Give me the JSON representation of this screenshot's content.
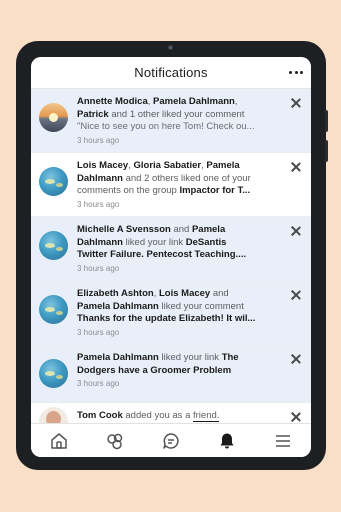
{
  "header": {
    "title": "Notifications",
    "more_icon": "more-horizontal-icon"
  },
  "notifications": [
    {
      "state": "unread",
      "avatar": "sunset-avatar",
      "lines": [
        {
          "parts": [
            [
              "b",
              "Annette Modica"
            ],
            [
              "t",
              ", "
            ],
            [
              "b",
              "Pamela Dahlmann"
            ],
            [
              "t",
              ","
            ]
          ]
        },
        {
          "parts": [
            [
              "b",
              "Patrick"
            ],
            [
              "t",
              " and 1 other liked your comment"
            ]
          ]
        },
        {
          "parts": [
            [
              "q",
              "\"Nice to see you on here Tom! Check ou..."
            ]
          ]
        }
      ],
      "time": "3 hours ago"
    },
    {
      "state": "read",
      "avatar": "ocean-avatar",
      "lines": [
        {
          "parts": [
            [
              "b",
              "Lois Macey"
            ],
            [
              "t",
              ", "
            ],
            [
              "b",
              "Gloria Sabatier"
            ],
            [
              "t",
              ", "
            ],
            [
              "b",
              "Pamela"
            ]
          ]
        },
        {
          "parts": [
            [
              "b",
              "Dahlmann"
            ],
            [
              "t",
              " and 2 others liked one of your"
            ]
          ]
        },
        {
          "parts": [
            [
              "t",
              "comments on the group "
            ],
            [
              "b",
              "Impactor for T..."
            ]
          ]
        }
      ],
      "time": "3 hours ago"
    },
    {
      "state": "unread",
      "avatar": "ocean-avatar",
      "lines": [
        {
          "parts": [
            [
              "b",
              "Michelle A Svensson"
            ],
            [
              "t",
              " and "
            ],
            [
              "b",
              "Pamela"
            ]
          ]
        },
        {
          "parts": [
            [
              "b",
              "Dahlmann"
            ],
            [
              "t",
              " liked your link "
            ],
            [
              "b",
              "DeSantis"
            ]
          ]
        },
        {
          "parts": [
            [
              "b",
              "Twitter Failure. Pentecost Teaching...."
            ]
          ]
        }
      ],
      "time": "3 hours ago"
    },
    {
      "state": "unread",
      "avatar": "ocean-avatar",
      "lines": [
        {
          "parts": [
            [
              "b",
              "Elizabeth Ashton"
            ],
            [
              "t",
              ", "
            ],
            [
              "b",
              "Lois Macey"
            ],
            [
              "t",
              " and"
            ]
          ]
        },
        {
          "parts": [
            [
              "b",
              "Pamela Dahlmann"
            ],
            [
              "t",
              " liked your comment"
            ]
          ]
        },
        {
          "parts": [
            [
              "b",
              "Thanks for the update Elizabeth! It wil..."
            ]
          ]
        }
      ],
      "time": "3 hours ago"
    },
    {
      "state": "unread",
      "avatar": "ocean-avatar",
      "lines": [
        {
          "parts": [
            [
              "b",
              "Pamela Dahlmann"
            ],
            [
              "t",
              " liked your link "
            ],
            [
              "b",
              "The"
            ]
          ]
        },
        {
          "parts": [
            [
              "b",
              "Dodgers have a Groomer Problem"
            ]
          ]
        }
      ],
      "time": "3 hours ago"
    },
    {
      "state": "read",
      "avatar": "person-avatar",
      "lines": [
        {
          "parts": [
            [
              "b",
              "Tom Cook"
            ],
            [
              "t",
              " added you as a "
            ],
            [
              "u",
              "friend."
            ]
          ]
        }
      ],
      "time": ""
    }
  ],
  "tabbar": {
    "items": [
      {
        "icon": "home-icon",
        "active": false
      },
      {
        "icon": "groups-icon",
        "active": false
      },
      {
        "icon": "chat-icon",
        "active": false
      },
      {
        "icon": "bell-icon",
        "active": true
      },
      {
        "icon": "menu-icon",
        "active": false
      }
    ]
  },
  "colors": {
    "background": "#f9dfc6",
    "tablet_frame": "#1e1f22",
    "unread_row": "#e9eff8",
    "text_primary": "#1a1a1a",
    "text_secondary": "#5b5e63"
  }
}
